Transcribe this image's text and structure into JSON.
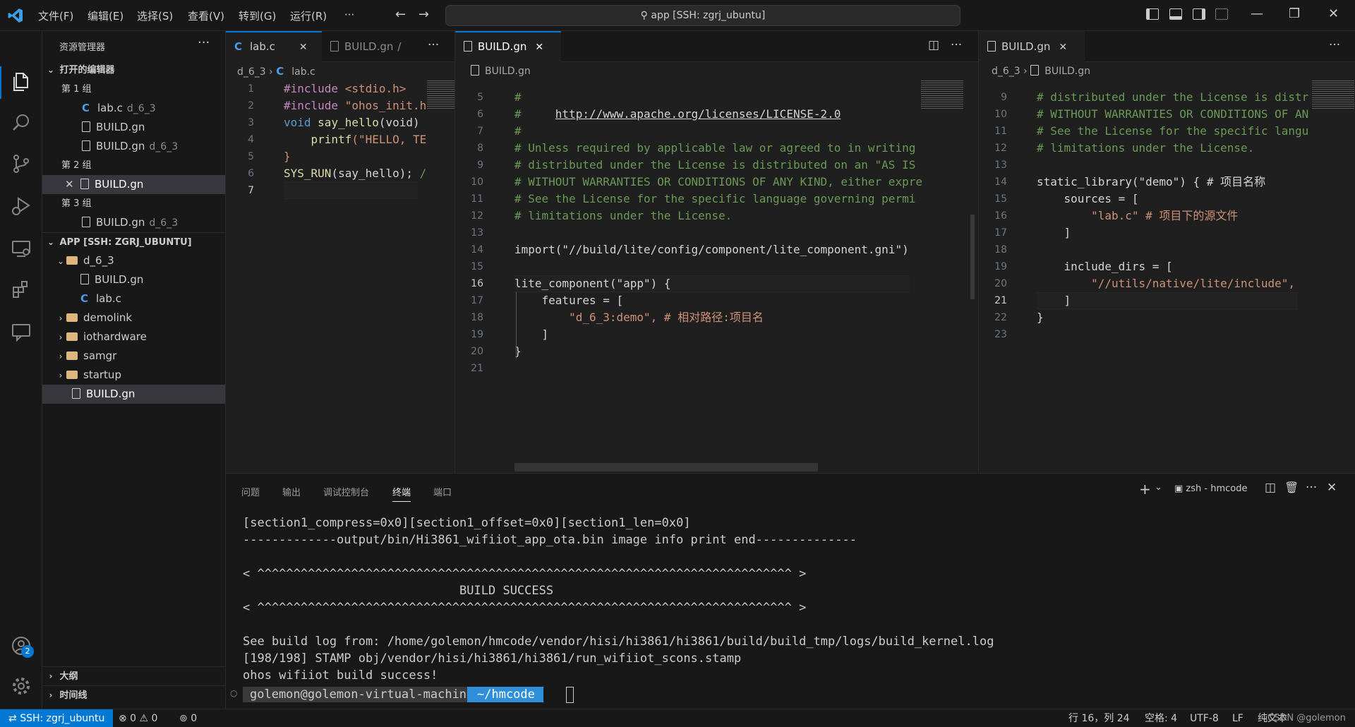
{
  "titlebar": {
    "menu": [
      "文件(F)",
      "编辑(E)",
      "选择(S)",
      "查看(V)",
      "转到(G)",
      "运行(R)",
      "···"
    ],
    "command_center": "app [SSH: zgrj_ubuntu]"
  },
  "activity_badge": "2",
  "sidebar": {
    "title": "资源管理器",
    "more": "···",
    "open_editors_title": "打开的编辑器",
    "groups": [
      {
        "label": "第 1 组",
        "files": [
          {
            "name": "lab.c",
            "desc": "d_6_3",
            "icon": "c-file-icon"
          },
          {
            "name": "BUILD.gn",
            "desc": "",
            "icon": "file-icon"
          },
          {
            "name": "BUILD.gn",
            "desc": "d_6_3",
            "icon": "file-icon"
          }
        ]
      },
      {
        "label": "第 2 组",
        "files": [
          {
            "name": "BUILD.gn",
            "desc": "",
            "icon": "file-icon"
          }
        ]
      },
      {
        "label": "第 3 组",
        "files": [
          {
            "name": "BUILD.gn",
            "desc": "d_6_3",
            "icon": "file-icon"
          }
        ]
      }
    ],
    "workspace_title": "APP [SSH: ZGRJ_UBUNTU]",
    "tree": [
      {
        "name": "d_6_3",
        "type": "folder-open"
      },
      {
        "name": "BUILD.gn",
        "type": "file"
      },
      {
        "name": "lab.c",
        "type": "c-file"
      },
      {
        "name": "demolink",
        "type": "folder"
      },
      {
        "name": "iothardware",
        "type": "folder"
      },
      {
        "name": "samgr",
        "type": "folder"
      },
      {
        "name": "startup",
        "type": "folder"
      },
      {
        "name": "BUILD.gn",
        "type": "file"
      }
    ],
    "outline": "大纲",
    "timeline": "时间线"
  },
  "editor1": {
    "tab": "lab.c",
    "tab2": "BUILD.gn",
    "tab2_suffix": "/",
    "breadcrumb_folder": "d_6_3",
    "breadcrumb_file": "lab.c",
    "lines": [
      {
        "n": "1",
        "a": "#include ",
        "b": "<stdio.h>",
        "c": ""
      },
      {
        "n": "2",
        "a": "#include ",
        "b": "\"ohos_init.h",
        "c": ""
      },
      {
        "n": "3",
        "a": "void ",
        "b": "say_hello",
        "c": "(void)"
      },
      {
        "n": "4",
        "a": "    ",
        "b": "printf",
        "c": "(\"HELLO, TE"
      },
      {
        "n": "5",
        "a": "}",
        "b": "",
        "c": ""
      },
      {
        "n": "6",
        "a": "SYS_RUN",
        "b": "(say_hello);",
        "c": " /"
      },
      {
        "n": "7",
        "a": "",
        "b": "",
        "c": ""
      }
    ]
  },
  "editor2": {
    "tab": "BUILD.gn",
    "breadcrumb_file": "BUILD.gn",
    "lines": [
      {
        "n": "5",
        "t": "#"
      },
      {
        "n": "6",
        "t": "#     ",
        "link": "http://www.apache.org/licenses/LICENSE-2.0"
      },
      {
        "n": "7",
        "t": "#"
      },
      {
        "n": "8",
        "t": "# Unless required by applicable law or agreed to in writing"
      },
      {
        "n": "9",
        "t": "# distributed under the License is distributed on an \"AS IS"
      },
      {
        "n": "10",
        "t": "# WITHOUT WARRANTIES OR CONDITIONS OF ANY KIND, either expre"
      },
      {
        "n": "11",
        "t": "# See the License for the specific language governing permi"
      },
      {
        "n": "12",
        "t": "# limitations under the License."
      },
      {
        "n": "13",
        "t": ""
      },
      {
        "n": "14",
        "t": "import(\"//build/lite/config/component/lite_component.gni\")"
      },
      {
        "n": "15",
        "t": ""
      },
      {
        "n": "16",
        "t": "lite_component(\"app\") {"
      },
      {
        "n": "17",
        "t": "    features = ["
      },
      {
        "n": "18",
        "t": "        \"d_6_3:demo\", # 相对路径:项目名"
      },
      {
        "n": "19",
        "t": "    ]"
      },
      {
        "n": "20",
        "t": "}"
      },
      {
        "n": "21",
        "t": ""
      }
    ]
  },
  "editor3": {
    "tab": "BUILD.gn",
    "breadcrumb_folder": "d_6_3",
    "breadcrumb_file": "BUILD.gn",
    "lines": [
      {
        "n": "9",
        "t": "# distributed under the License is distr"
      },
      {
        "n": "10",
        "t": "# WITHOUT WARRANTIES OR CONDITIONS OF AN"
      },
      {
        "n": "11",
        "t": "# See the License for the specific langu"
      },
      {
        "n": "12",
        "t": "# limitations under the License."
      },
      {
        "n": "13",
        "t": ""
      },
      {
        "n": "14",
        "t": "static_library(\"demo\") { # 项目名称"
      },
      {
        "n": "15",
        "t": "    sources = ["
      },
      {
        "n": "16",
        "t": "        \"lab.c\" # 项目下的源文件"
      },
      {
        "n": "17",
        "t": "    ]"
      },
      {
        "n": "18",
        "t": ""
      },
      {
        "n": "19",
        "t": "    include_dirs = ["
      },
      {
        "n": "20",
        "t": "        \"//utils/native/lite/include\","
      },
      {
        "n": "21",
        "t": "    ]"
      },
      {
        "n": "22",
        "t": "}"
      },
      {
        "n": "23",
        "t": ""
      }
    ]
  },
  "panel": {
    "tabs": [
      "问题",
      "输出",
      "调试控制台",
      "终端",
      "端口"
    ],
    "active_tab": "终端",
    "terminal_name": "zsh - hmcode",
    "terminal_lines": [
      "[section1_compress=0x0][section1_offset=0x0][section1_len=0x0]",
      "-------------output/bin/Hi3861_wifiiot_app_ota.bin image info print end--------------",
      "",
      "< ^^^^^^^^^^^^^^^^^^^^^^^^^^^^^^^^^^^^^^^^^^^^^^^^^^^^^^^^^^^^^^^^^^^^^^^^^^ >",
      "                              BUILD SUCCESS",
      "< ^^^^^^^^^^^^^^^^^^^^^^^^^^^^^^^^^^^^^^^^^^^^^^^^^^^^^^^^^^^^^^^^^^^^^^^^^^ >",
      "",
      "See build log from: /home/golemon/hmcode/vendor/hisi/hi3861/hi3861/build/build_tmp/logs/build_kernel.log",
      "[198/198] STAMP obj/vendor/hisi/hi3861/hi3861/run_wifiiot_scons.stamp",
      "ohos wifiiot build success!"
    ],
    "prompt_user": "golemon@golemon-virtual-machine",
    "prompt_path": "~/hmcode"
  },
  "statusbar": {
    "remote": "SSH: zgrj_ubuntu",
    "problems": "⊗ 0  ⚠ 0",
    "ports": "0",
    "position": "行 16，列 24",
    "indent": "空格: 4",
    "encoding": "UTF-8",
    "eol": "LF",
    "lang": "纯文本",
    "watermark": "CSDN @golemon"
  }
}
